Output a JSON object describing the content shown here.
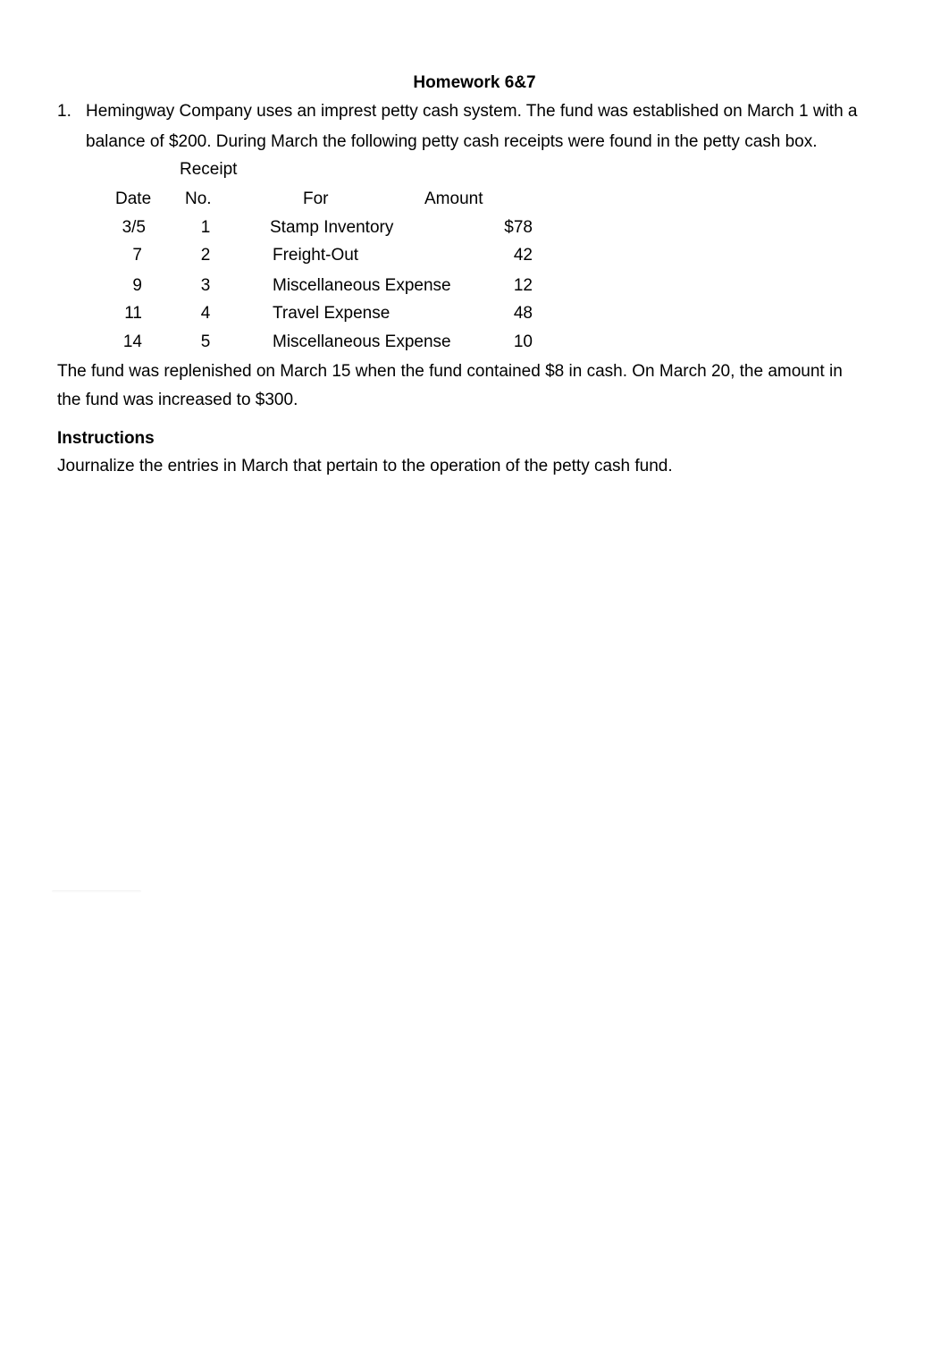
{
  "document": {
    "title": "Homework 6&7",
    "problem_number": "1.",
    "problem_line1": "Hemingway Company uses an imprest petty cash system. The fund was established on March 1 with a",
    "problem_line2": "balance of $200. During March the following petty cash receipts were found in the petty cash box.",
    "table": {
      "header_top": "Receipt",
      "headers": [
        "Date",
        "No.",
        "For",
        "Amount"
      ],
      "rows": [
        {
          "date": "3/5",
          "no": "1",
          "for": "Stamp Inventory",
          "amount": "$78"
        },
        {
          "date": "7",
          "no": "2",
          "for": "Freight-Out",
          "amount": "42"
        },
        {
          "date": "9",
          "no": "3",
          "for": "Miscellaneous Expense",
          "amount": "12"
        },
        {
          "date": "11",
          "no": "4",
          "for": "Travel Expense",
          "amount": "48"
        },
        {
          "date": "14",
          "no": "5",
          "for": "Miscellaneous Expense",
          "amount": "10"
        }
      ]
    },
    "followup_line1": "The fund was replenished on March 15 when the fund contained $8 in cash. On March 20, the amount in",
    "followup_line2": "the fund was increased to $300.",
    "instructions_heading": "Instructions",
    "instructions_text": "Journalize the entries in March that pertain to the operation of the petty cash fund."
  }
}
